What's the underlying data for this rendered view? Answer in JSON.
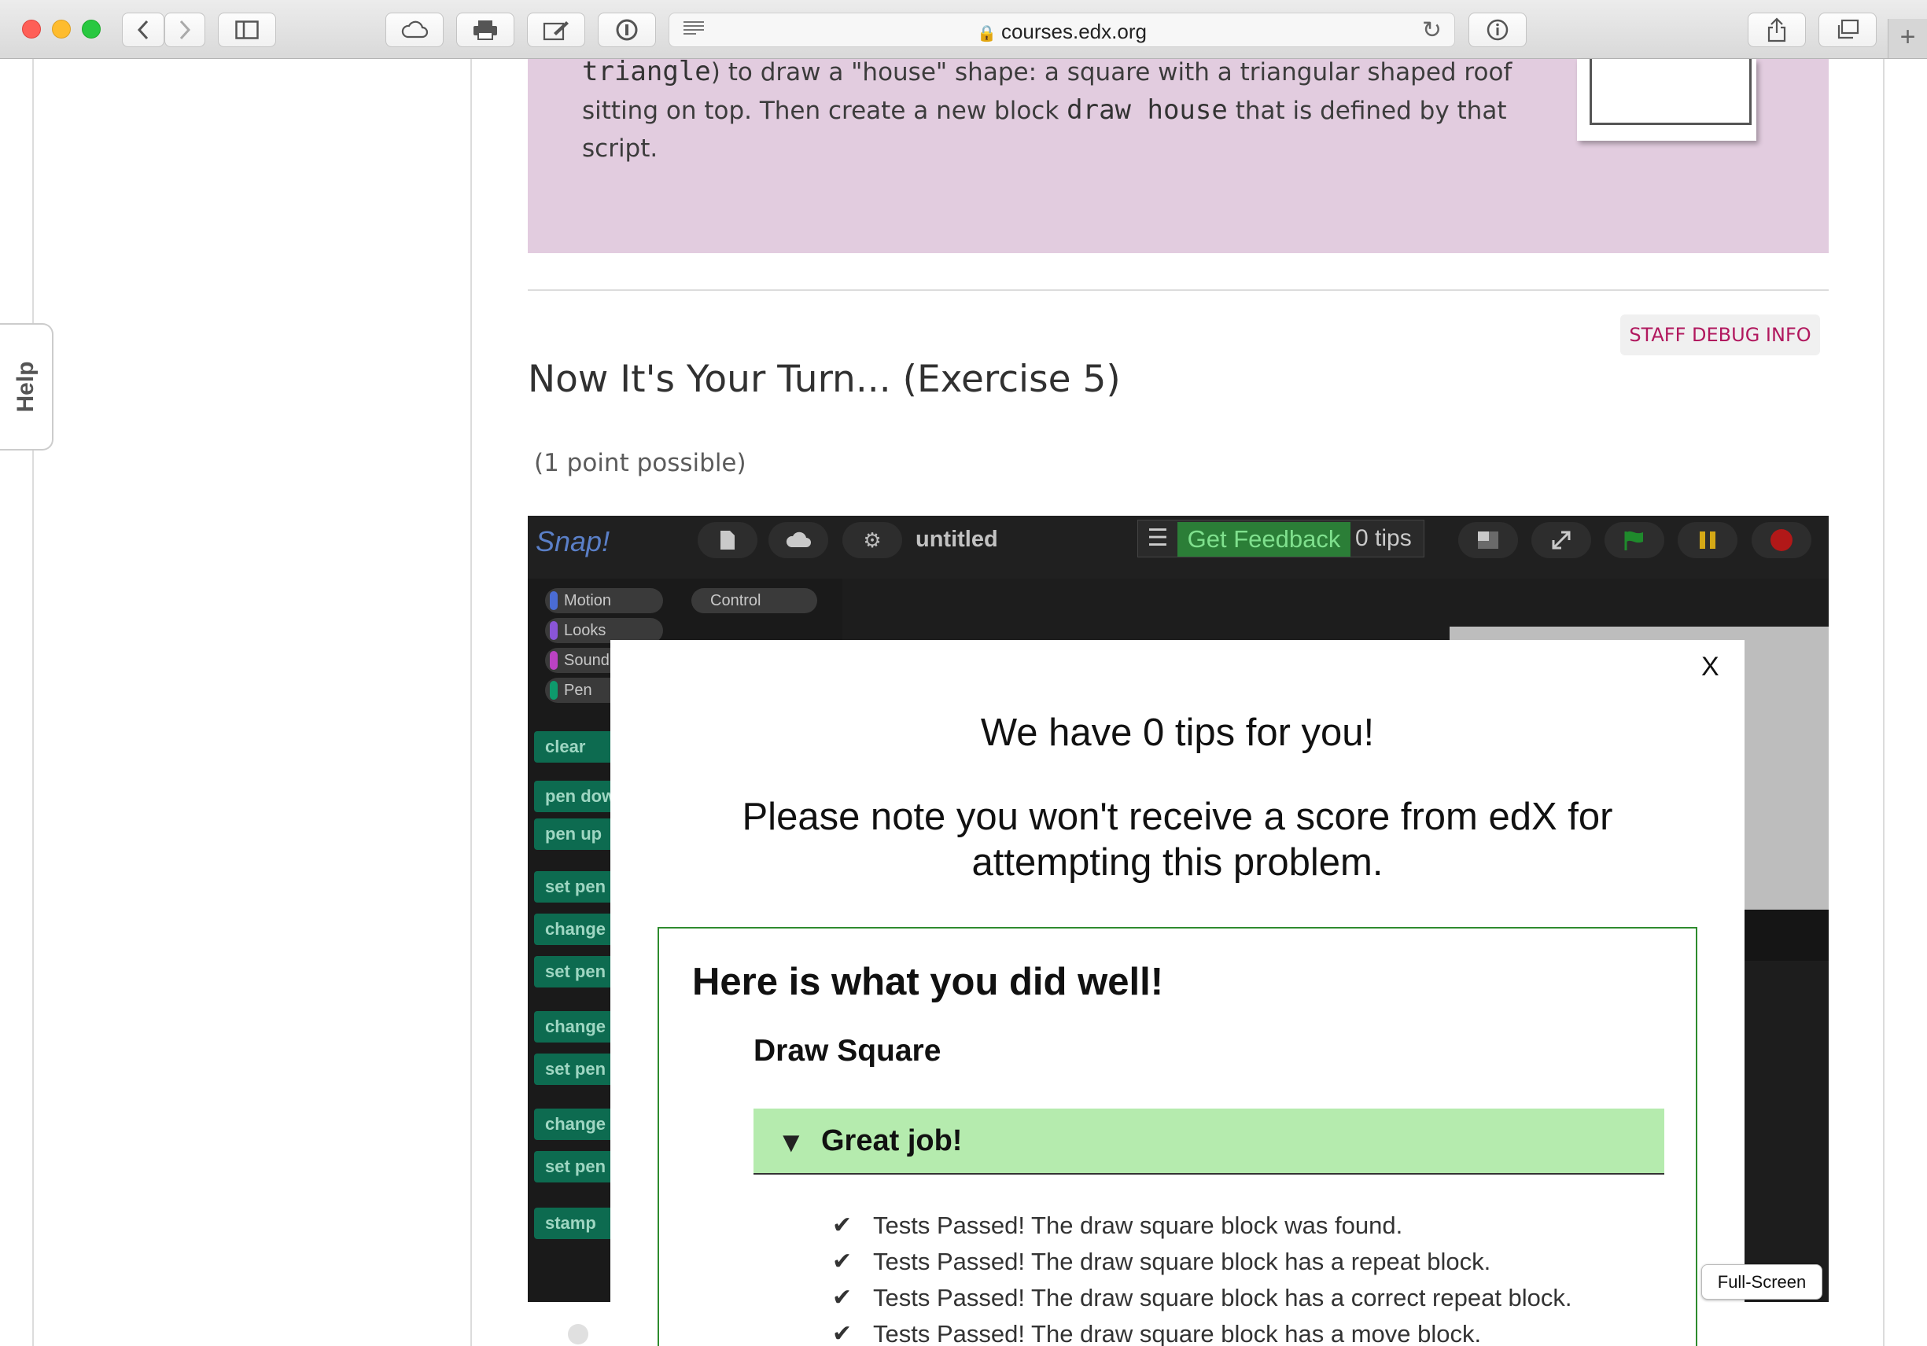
{
  "browser": {
    "url": "courses.edx.org",
    "new_tab_label": "+"
  },
  "help_tab": {
    "label": "Help"
  },
  "instructions": {
    "line1_code": "triangle",
    "line1_rest": ") to draw a \"house\" shape: a square with a triangular shaped roof",
    "line2_start": "sitting on top. Then create a new block ",
    "line2_code": "draw house",
    "line2_end": " that is defined by that",
    "line3": "script."
  },
  "staff_debug": {
    "label": "STAFF DEBUG INFO"
  },
  "exercise": {
    "title": "Now It's Your Turn... (Exercise 5)",
    "points": "(1 point possible)"
  },
  "snap": {
    "logo": "Snap!",
    "project_name": "untitled",
    "feedback_button": "Get Feedback",
    "tips_label": "0 tips",
    "categories": [
      "Motion",
      "Looks",
      "Sound",
      "Pen",
      "Control"
    ],
    "blocks": [
      "clear",
      "pen down",
      "pen up",
      "set pen",
      "change",
      "set pen",
      "change",
      "set pen",
      "change",
      "set pen",
      "stamp"
    ]
  },
  "modal": {
    "close": "X",
    "heading": "We have 0 tips for you!",
    "note": "Please note you won't receive a score from edX for attempting this problem.",
    "well_title": "Here is what you did well!",
    "section_title": "Draw Square",
    "great_label": "Great job!",
    "tests": [
      "Tests Passed! The draw square block was found.",
      "Tests Passed! The draw square block has a repeat block.",
      "Tests Passed! The draw square block has a correct repeat block.",
      "Tests Passed! The draw square block has a move block."
    ],
    "check_glyph": "✔",
    "triangle_glyph": "▼"
  },
  "fullscreen": {
    "label": "Full-Screen"
  },
  "colors": {
    "accent_purple_bg": "#e2ccdf",
    "staff_debug_text": "#b1185e",
    "success_bg": "#b5ebae",
    "success_border": "#2e8b2e",
    "snap_feedback": "#2b7e37"
  }
}
